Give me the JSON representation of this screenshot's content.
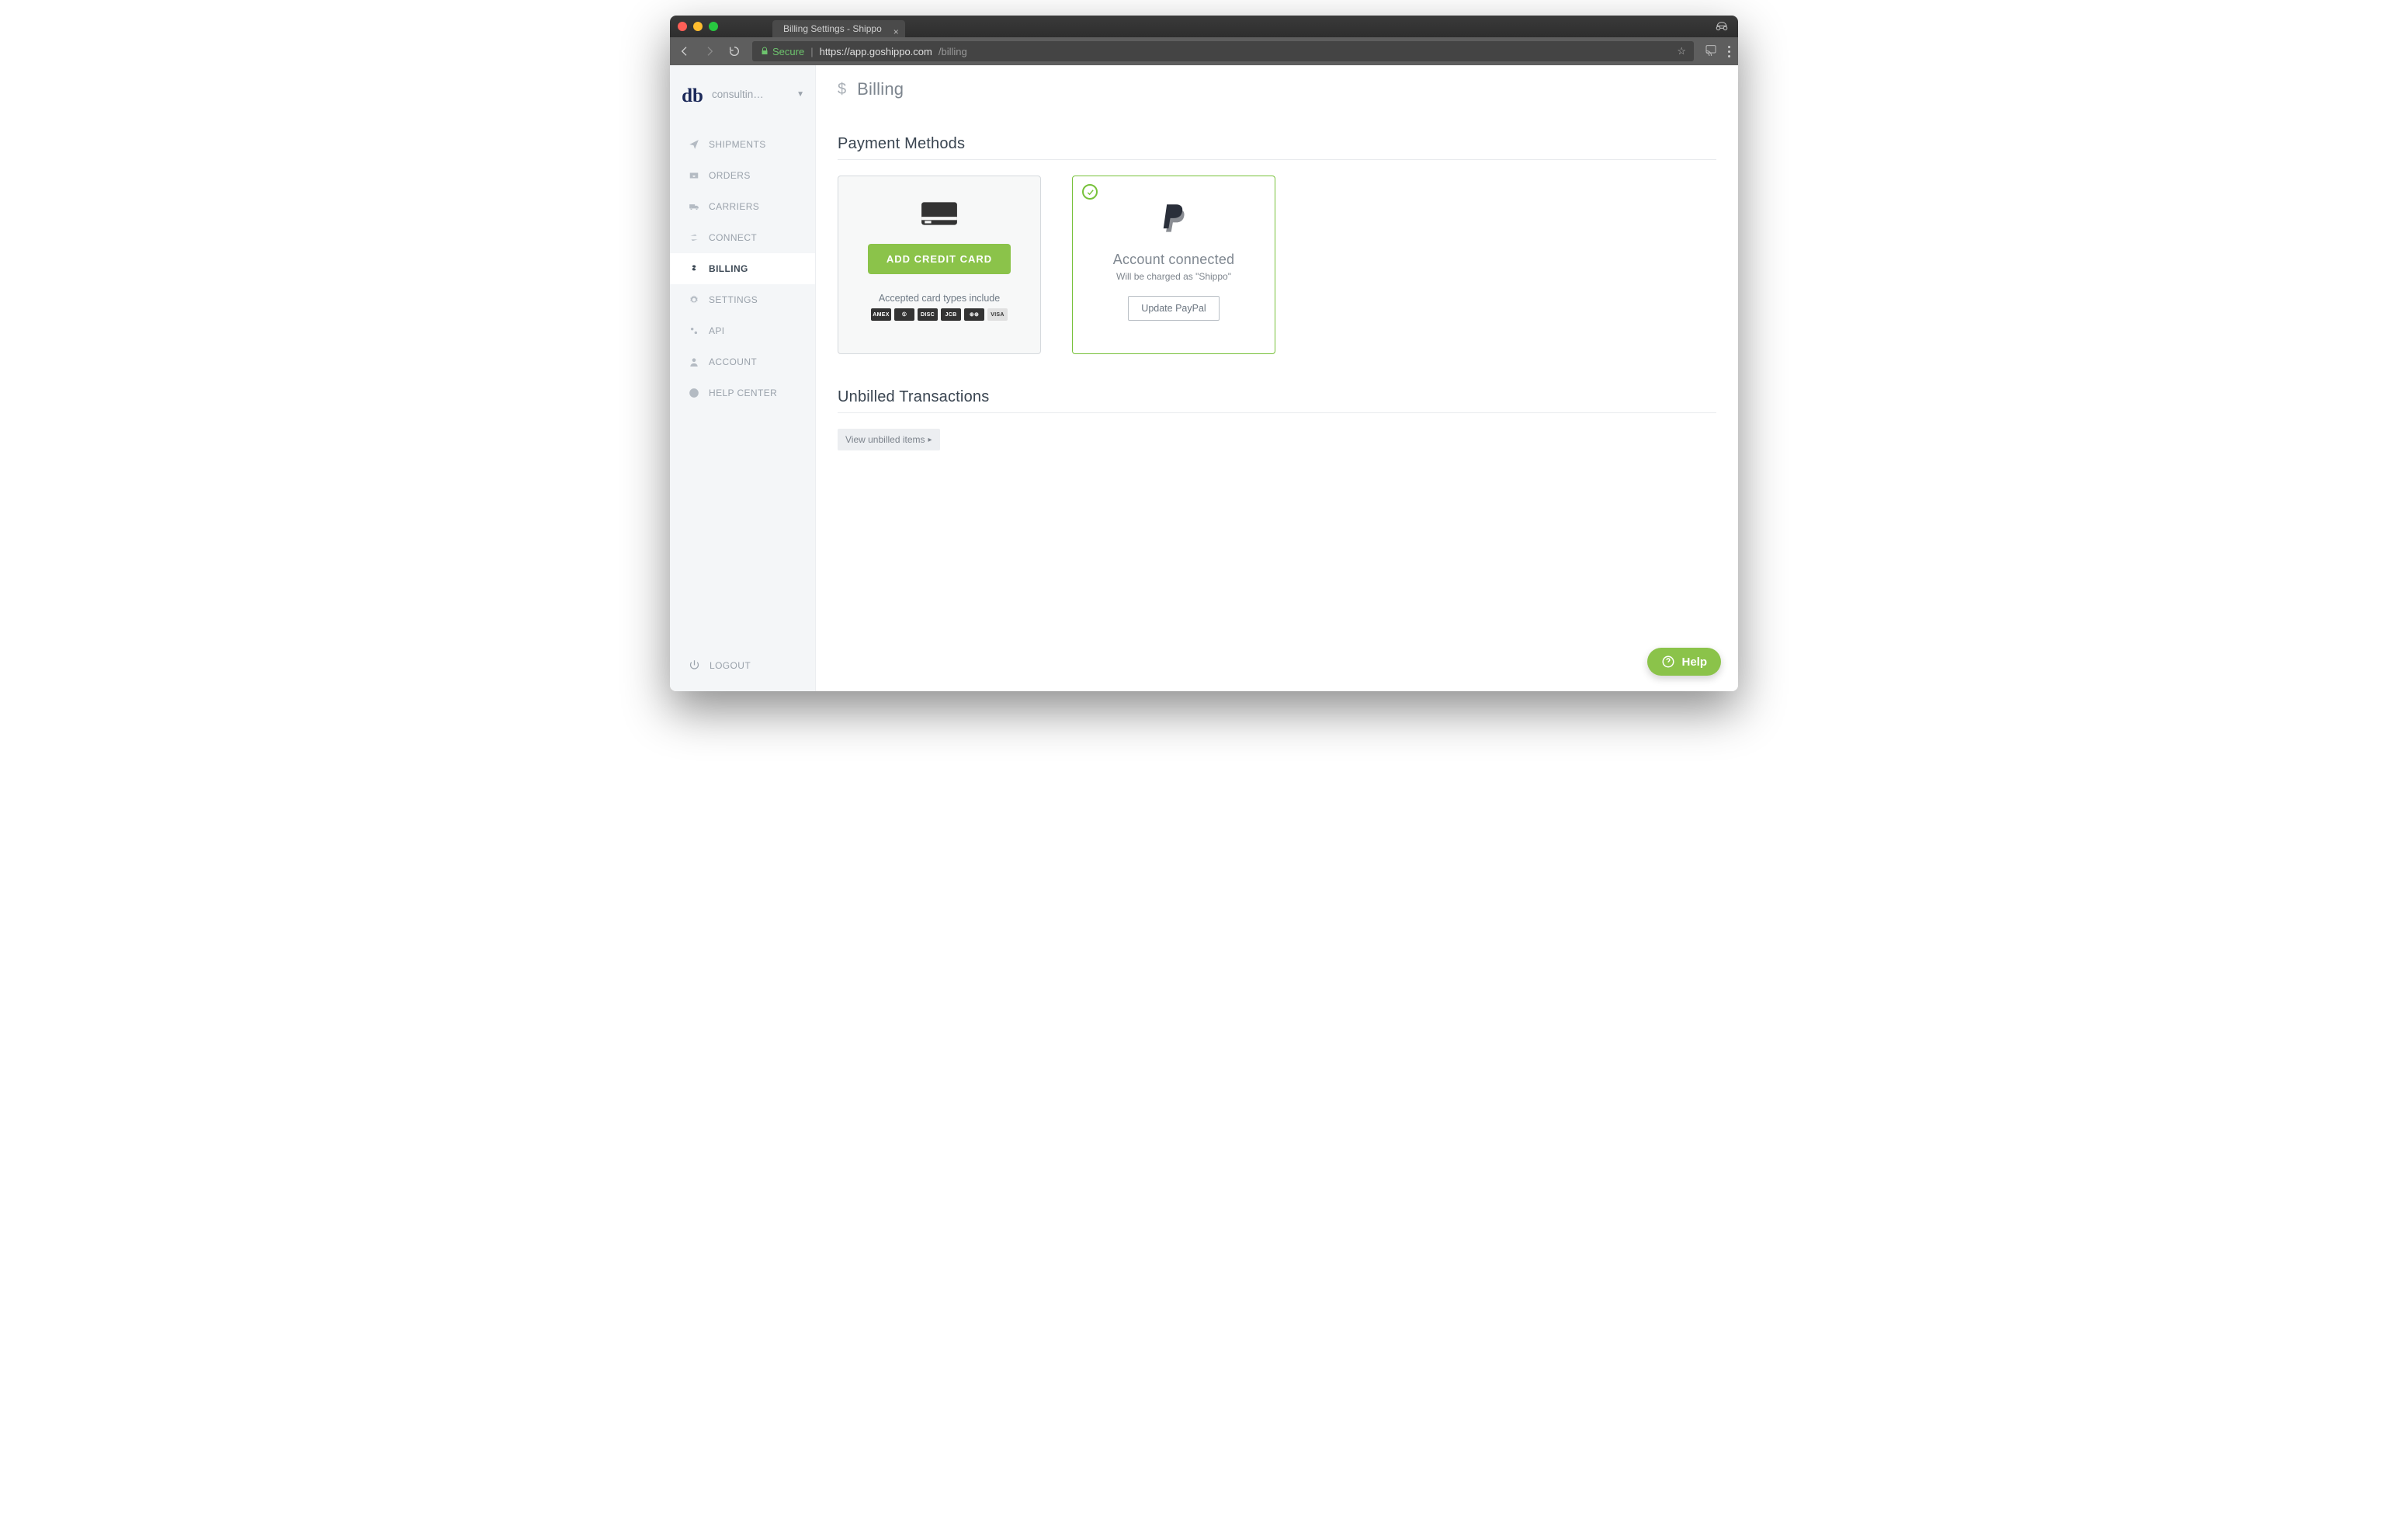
{
  "browser": {
    "tab_title": "Billing Settings - Shippo",
    "secure_label": "Secure",
    "url_host": "https://app.goshippo.com",
    "url_path": "/billing"
  },
  "account": {
    "logo_text": "db",
    "name": "consultin…"
  },
  "sidebar": {
    "items": [
      {
        "label": "SHIPMENTS",
        "active": false
      },
      {
        "label": "ORDERS",
        "active": false
      },
      {
        "label": "CARRIERS",
        "active": false
      },
      {
        "label": "CONNECT",
        "active": false
      },
      {
        "label": "BILLING",
        "active": true
      },
      {
        "label": "SETTINGS",
        "active": false
      },
      {
        "label": "API",
        "active": false
      },
      {
        "label": "ACCOUNT",
        "active": false
      },
      {
        "label": "HELP CENTER",
        "active": false
      }
    ],
    "logout_label": "LOGOUT"
  },
  "page": {
    "title": "Billing",
    "payment_methods_header": "Payment Methods",
    "unbilled_header": "Unbilled Transactions"
  },
  "credit_card": {
    "button_label": "ADD CREDIT CARD",
    "accepted_note": "Accepted card types include",
    "brands": [
      "AMEX",
      "①",
      "DISC",
      "JCB",
      "⊕⊕",
      "VISA"
    ]
  },
  "paypal": {
    "status": "Account connected",
    "note": "Will be charged as \"Shippo\"",
    "update_label": "Update PayPal"
  },
  "unbilled": {
    "view_button": "View unbilled items"
  },
  "help": {
    "label": "Help"
  }
}
